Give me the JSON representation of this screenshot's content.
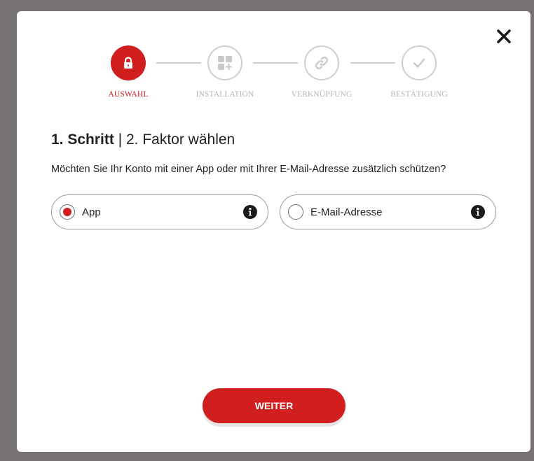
{
  "dialog": {
    "close_icon": "close-icon"
  },
  "stepper": {
    "steps": [
      {
        "label": "AUSWAHL",
        "icon": "lock-icon",
        "state": "active"
      },
      {
        "label": "INSTALLATION",
        "icon": "app-grid-icon",
        "state": "inactive"
      },
      {
        "label": "VERKNÜPFUNG",
        "icon": "link-icon",
        "state": "inactive"
      },
      {
        "label": "BESTÄTIGUNG",
        "icon": "check-icon",
        "state": "inactive"
      }
    ]
  },
  "heading": {
    "bold": "1. Schritt",
    "separator": " | ",
    "rest": "2. Faktor wählen"
  },
  "question": "Möchten Sie Ihr Konto mit einer App oder mit Ihrer E-Mail-Adresse zusätzlich schützen?",
  "options": [
    {
      "label": "App",
      "selected": true
    },
    {
      "label": "E-Mail-Adresse",
      "selected": false
    }
  ],
  "submit_label": "WEITER",
  "colors": {
    "accent": "#d11f1f",
    "backdrop": "#767271",
    "inactive": "#cfcfcf"
  }
}
